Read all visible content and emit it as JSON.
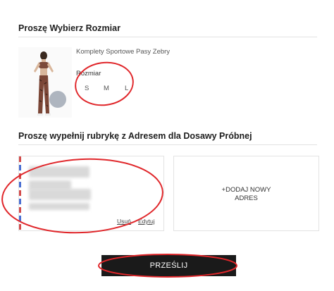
{
  "section_size": {
    "title": "Proszę Wybierz Rozmiar"
  },
  "product": {
    "name": "Komplety Sportowe Pasy Zebry",
    "size_label": "Rozmiar",
    "sizes": [
      "S",
      "M",
      "L"
    ]
  },
  "section_address": {
    "title": "Proszę wypełnij rubrykę z Adresem dla Dosawy Próbnej"
  },
  "address_card": {
    "remove_label": "Usuń",
    "edit_label": "Edytuj"
  },
  "add_address": {
    "label": "+DODAJ NOWY\nADRES"
  },
  "submit": {
    "label": "PRZEŚLIJ"
  },
  "colors": {
    "annotation_red": "#e0262a",
    "button_bg": "#1a1a1a",
    "divider": "#e2e2e2"
  }
}
